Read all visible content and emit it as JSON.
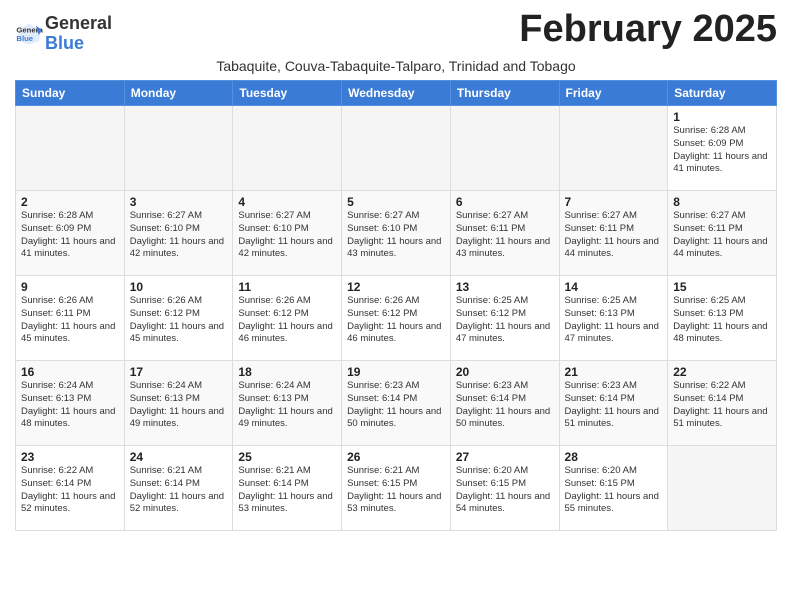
{
  "header": {
    "logo_general": "General",
    "logo_blue": "Blue",
    "month_title": "February 2025",
    "subtitle": "Tabaquite, Couva-Tabaquite-Talparo, Trinidad and Tobago"
  },
  "weekdays": [
    "Sunday",
    "Monday",
    "Tuesday",
    "Wednesday",
    "Thursday",
    "Friday",
    "Saturday"
  ],
  "weeks": [
    [
      {
        "day": "",
        "info": ""
      },
      {
        "day": "",
        "info": ""
      },
      {
        "day": "",
        "info": ""
      },
      {
        "day": "",
        "info": ""
      },
      {
        "day": "",
        "info": ""
      },
      {
        "day": "",
        "info": ""
      },
      {
        "day": "1",
        "info": "Sunrise: 6:28 AM\nSunset: 6:09 PM\nDaylight: 11 hours and 41 minutes."
      }
    ],
    [
      {
        "day": "2",
        "info": "Sunrise: 6:28 AM\nSunset: 6:09 PM\nDaylight: 11 hours and 41 minutes."
      },
      {
        "day": "3",
        "info": "Sunrise: 6:27 AM\nSunset: 6:10 PM\nDaylight: 11 hours and 42 minutes."
      },
      {
        "day": "4",
        "info": "Sunrise: 6:27 AM\nSunset: 6:10 PM\nDaylight: 11 hours and 42 minutes."
      },
      {
        "day": "5",
        "info": "Sunrise: 6:27 AM\nSunset: 6:10 PM\nDaylight: 11 hours and 43 minutes."
      },
      {
        "day": "6",
        "info": "Sunrise: 6:27 AM\nSunset: 6:11 PM\nDaylight: 11 hours and 43 minutes."
      },
      {
        "day": "7",
        "info": "Sunrise: 6:27 AM\nSunset: 6:11 PM\nDaylight: 11 hours and 44 minutes."
      },
      {
        "day": "8",
        "info": "Sunrise: 6:27 AM\nSunset: 6:11 PM\nDaylight: 11 hours and 44 minutes."
      }
    ],
    [
      {
        "day": "9",
        "info": "Sunrise: 6:26 AM\nSunset: 6:11 PM\nDaylight: 11 hours and 45 minutes."
      },
      {
        "day": "10",
        "info": "Sunrise: 6:26 AM\nSunset: 6:12 PM\nDaylight: 11 hours and 45 minutes."
      },
      {
        "day": "11",
        "info": "Sunrise: 6:26 AM\nSunset: 6:12 PM\nDaylight: 11 hours and 46 minutes."
      },
      {
        "day": "12",
        "info": "Sunrise: 6:26 AM\nSunset: 6:12 PM\nDaylight: 11 hours and 46 minutes."
      },
      {
        "day": "13",
        "info": "Sunrise: 6:25 AM\nSunset: 6:12 PM\nDaylight: 11 hours and 47 minutes."
      },
      {
        "day": "14",
        "info": "Sunrise: 6:25 AM\nSunset: 6:13 PM\nDaylight: 11 hours and 47 minutes."
      },
      {
        "day": "15",
        "info": "Sunrise: 6:25 AM\nSunset: 6:13 PM\nDaylight: 11 hours and 48 minutes."
      }
    ],
    [
      {
        "day": "16",
        "info": "Sunrise: 6:24 AM\nSunset: 6:13 PM\nDaylight: 11 hours and 48 minutes."
      },
      {
        "day": "17",
        "info": "Sunrise: 6:24 AM\nSunset: 6:13 PM\nDaylight: 11 hours and 49 minutes."
      },
      {
        "day": "18",
        "info": "Sunrise: 6:24 AM\nSunset: 6:13 PM\nDaylight: 11 hours and 49 minutes."
      },
      {
        "day": "19",
        "info": "Sunrise: 6:23 AM\nSunset: 6:14 PM\nDaylight: 11 hours and 50 minutes."
      },
      {
        "day": "20",
        "info": "Sunrise: 6:23 AM\nSunset: 6:14 PM\nDaylight: 11 hours and 50 minutes."
      },
      {
        "day": "21",
        "info": "Sunrise: 6:23 AM\nSunset: 6:14 PM\nDaylight: 11 hours and 51 minutes."
      },
      {
        "day": "22",
        "info": "Sunrise: 6:22 AM\nSunset: 6:14 PM\nDaylight: 11 hours and 51 minutes."
      }
    ],
    [
      {
        "day": "23",
        "info": "Sunrise: 6:22 AM\nSunset: 6:14 PM\nDaylight: 11 hours and 52 minutes."
      },
      {
        "day": "24",
        "info": "Sunrise: 6:21 AM\nSunset: 6:14 PM\nDaylight: 11 hours and 52 minutes."
      },
      {
        "day": "25",
        "info": "Sunrise: 6:21 AM\nSunset: 6:14 PM\nDaylight: 11 hours and 53 minutes."
      },
      {
        "day": "26",
        "info": "Sunrise: 6:21 AM\nSunset: 6:15 PM\nDaylight: 11 hours and 53 minutes."
      },
      {
        "day": "27",
        "info": "Sunrise: 6:20 AM\nSunset: 6:15 PM\nDaylight: 11 hours and 54 minutes."
      },
      {
        "day": "28",
        "info": "Sunrise: 6:20 AM\nSunset: 6:15 PM\nDaylight: 11 hours and 55 minutes."
      },
      {
        "day": "",
        "info": ""
      }
    ]
  ]
}
